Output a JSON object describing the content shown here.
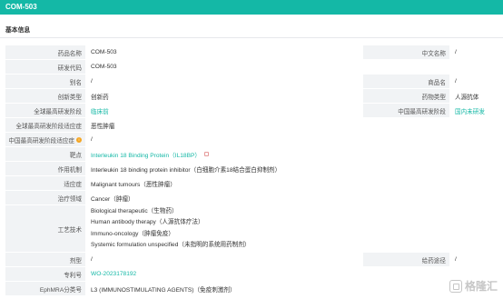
{
  "header": {
    "title": "COM-503"
  },
  "section": {
    "title": "基本信息"
  },
  "rows": [
    {
      "label": "药品名称",
      "value": "COM-503",
      "label2": "中文名称",
      "value2": "/"
    },
    {
      "label": "研发代码",
      "value": "COM-503"
    },
    {
      "label": "别名",
      "value": "/",
      "label2": "商品名",
      "value2": "/"
    },
    {
      "label": "创新类型",
      "value": "创新药",
      "label2": "药物类型",
      "value2": "人源抗体"
    },
    {
      "label": "全球最高研发阶段",
      "value": "临床前",
      "label2": "中国最高研发阶段",
      "value2": "国内未研发"
    },
    {
      "label": "全球最高研发阶段适应症",
      "value": "恶性肿瘤"
    },
    {
      "label": "中国最高研发阶段适应症",
      "value": "/"
    },
    {
      "label": "靶点",
      "value": "Interleukin 18 Binding Protein（IL18BP）"
    },
    {
      "label": "作用机制",
      "value": "Interleukin 18 binding protein inhibitor（白细胞介素18结合蛋白抑制剂）"
    },
    {
      "label": "适应症",
      "value": "Malignant tumours（恶性肿瘤）"
    },
    {
      "label": "治疗领域",
      "value": "Cancer（肿瘤）"
    },
    {
      "label": "工艺技术",
      "values": [
        "Biological therapeutic（生物药）",
        "Human antibody therapy（人源抗体疗法）",
        "Immuno-oncology（肿瘤免疫）",
        "Systemic formulation unspecified（未指明的系统用药制剂）"
      ]
    },
    {
      "label": "剂型",
      "value": "/",
      "label2": "给药途径",
      "value2": "/"
    },
    {
      "label": "专利号",
      "value": "WO-2023178192"
    },
    {
      "label": "EphMRA分类号",
      "value": "L3 (IMMUNOSTIMULATING AGENTS)（免疫刺激剂）"
    }
  ],
  "watermark": {
    "text": "格隆汇"
  },
  "colors": {
    "accent": "#14b8a6",
    "label_bg": "#f1f3f5",
    "info": "#f5a623"
  }
}
